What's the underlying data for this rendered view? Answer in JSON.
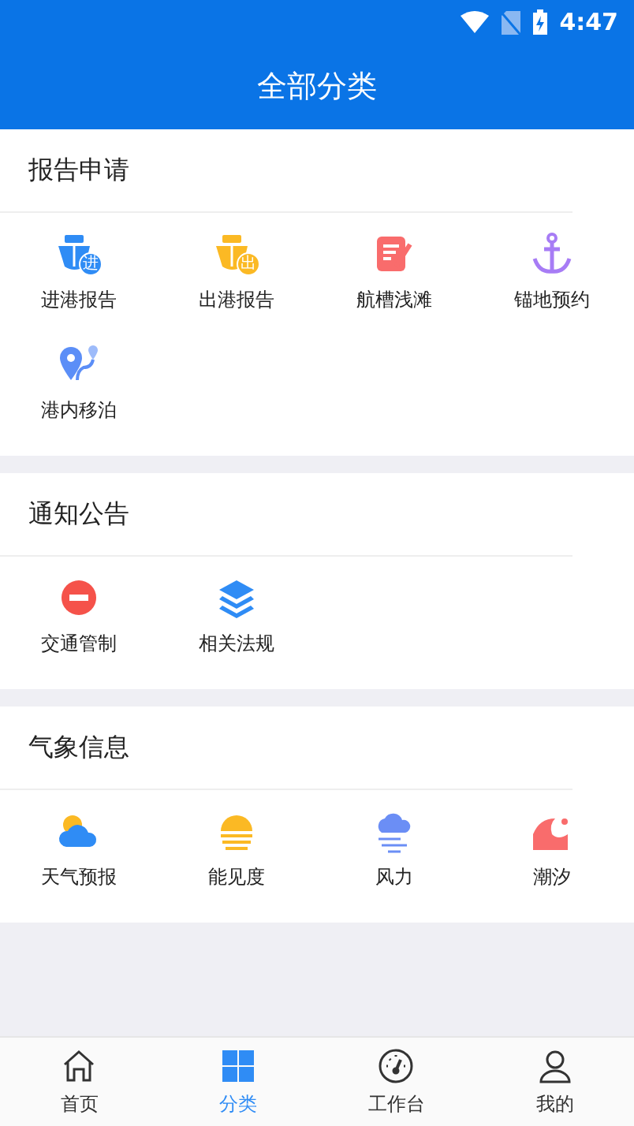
{
  "status_bar": {
    "time": "4:47"
  },
  "header": {
    "title": "全部分类"
  },
  "sections": [
    {
      "title": "报告申请",
      "items": [
        {
          "label": "进港报告",
          "kind": "ship",
          "color": "#2f8cf5",
          "badge": "进"
        },
        {
          "label": "出港报告",
          "kind": "ship",
          "color": "#fbb924",
          "badge": "出"
        },
        {
          "label": "航槽浅滩",
          "kind": "note",
          "color": "#f96c6c"
        },
        {
          "label": "锚地预约",
          "kind": "anchor",
          "color": "#a77cf5"
        },
        {
          "label": "港内移泊",
          "kind": "route",
          "color": "#5b8ef7"
        }
      ]
    },
    {
      "title": "通知公告",
      "items": [
        {
          "label": "交通管制",
          "kind": "noentry",
          "color": "#f5524a"
        },
        {
          "label": "相关法规",
          "kind": "layers",
          "color": "#2f8cf5"
        }
      ]
    },
    {
      "title": "气象信息",
      "items": [
        {
          "label": "天气预报",
          "kind": "cloud",
          "color": "#2f8cf5"
        },
        {
          "label": "能见度",
          "kind": "sun",
          "color": "#fbb924"
        },
        {
          "label": "风力",
          "kind": "wind",
          "color": "#6b8ef5"
        },
        {
          "label": "潮汐",
          "kind": "wave",
          "color": "#f96c6c"
        }
      ]
    }
  ],
  "tabs": [
    {
      "label": "首页",
      "kind": "home",
      "selected": false
    },
    {
      "label": "分类",
      "kind": "grid",
      "selected": true
    },
    {
      "label": "工作台",
      "kind": "gauge",
      "selected": false
    },
    {
      "label": "我的",
      "kind": "person",
      "selected": false
    }
  ]
}
